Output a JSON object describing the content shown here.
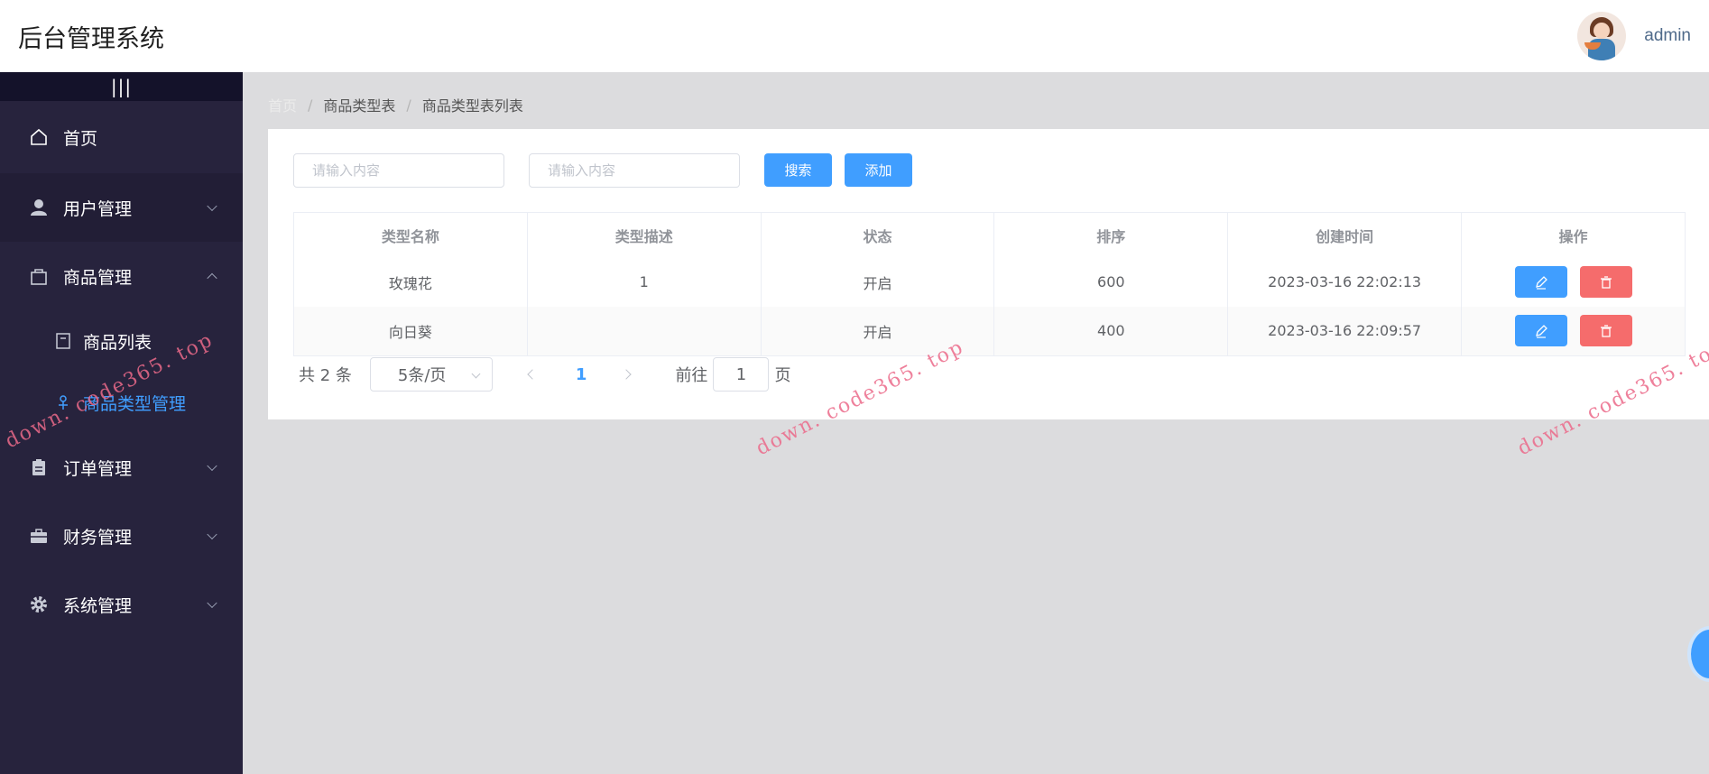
{
  "header": {
    "title": "后台管理系统",
    "username": "admin"
  },
  "sidebar": {
    "collapse_glyph": "|||",
    "items": [
      {
        "label": "首页",
        "icon": "home-icon"
      },
      {
        "label": "用户管理",
        "icon": "user-icon"
      },
      {
        "label": "商品管理",
        "icon": "bag-icon",
        "children": [
          {
            "label": "商品列表",
            "icon": "list-icon"
          },
          {
            "label": "商品类型管理",
            "icon": "tag-icon",
            "selected": true
          }
        ]
      },
      {
        "label": "订单管理",
        "icon": "clipboard-icon"
      },
      {
        "label": "财务管理",
        "icon": "briefcase-icon"
      },
      {
        "label": "系统管理",
        "icon": "gear-icon"
      }
    ]
  },
  "breadcrumb": {
    "home": "首页",
    "level1": "商品类型表",
    "level2": "商品类型表列表"
  },
  "search": {
    "input1_placeholder": "请输入内容",
    "input2_placeholder": "请输入内容",
    "search_label": "搜索",
    "add_label": "添加"
  },
  "table": {
    "columns": [
      "类型名称",
      "类型描述",
      "状态",
      "排序",
      "创建时间",
      "操作"
    ],
    "rows": [
      {
        "name": "玫瑰花",
        "desc": "1",
        "status": "开启",
        "sort": "600",
        "created": "2023-03-16 22:02:13"
      },
      {
        "name": "向日葵",
        "desc": "",
        "status": "开启",
        "sort": "400",
        "created": "2023-03-16 22:09:57"
      }
    ]
  },
  "pagination": {
    "total": "共 2 条",
    "page_size": "5条/页",
    "current_page": "1",
    "goto_label": "前往",
    "goto_value": "1",
    "goto_suffix": "页"
  },
  "watermark": "down. code365. top",
  "colors": {
    "accent": "#409eff",
    "danger": "#f56c6c",
    "sidebar": "#27233d"
  }
}
